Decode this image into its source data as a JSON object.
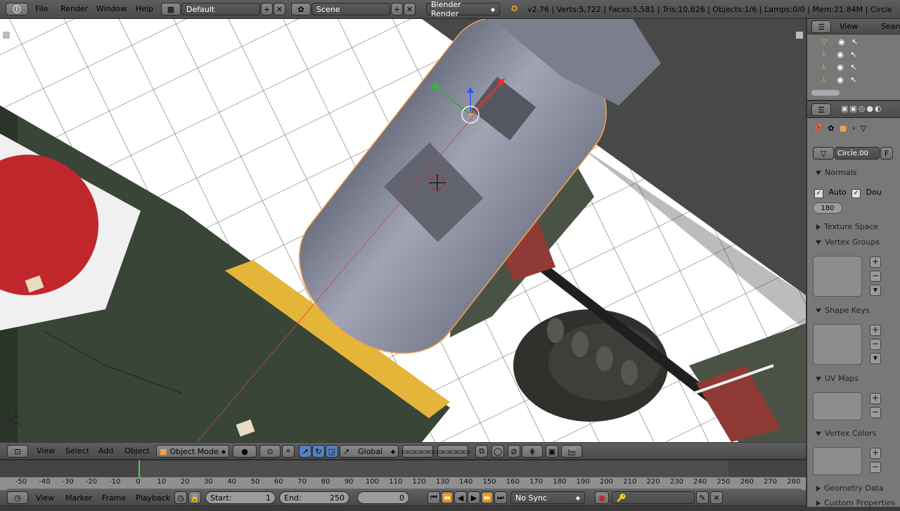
{
  "top": {
    "menus": [
      "File",
      "Render",
      "Window",
      "Help"
    ],
    "layout": "Default",
    "scene": "Scene",
    "engine": "Blender Render",
    "stats": "v2.76 | Verts:5,722 | Faces:5,581 | Tris:10,626 | Objects:1/6 | Lamps:0/0 | Mem:21.84M | Circle"
  },
  "outliner": {
    "view": "View",
    "search": "Search"
  },
  "properties": {
    "mesh_name": "Circle.00",
    "fake_user": "F",
    "normals": "Normals",
    "auto_smooth": "Auto",
    "double_sided": "Dou",
    "angle": "180",
    "panels": [
      "Texture Space",
      "Vertex Groups",
      "Shape Keys",
      "UV Maps",
      "Vertex Colors",
      "Geometry Data",
      "Custom Properties"
    ]
  },
  "view3d_header": {
    "menus": [
      "View",
      "Select",
      "Add",
      "Object"
    ],
    "mode": "Object Mode",
    "orientation": "Global"
  },
  "timeline": {
    "ticks": [
      "-50",
      "-40",
      "-30",
      "-20",
      "-10",
      "0",
      "10",
      "20",
      "30",
      "40",
      "50",
      "60",
      "70",
      "80",
      "90",
      "100",
      "110",
      "120",
      "130",
      "140",
      "150",
      "160",
      "170",
      "180",
      "190",
      "200",
      "210",
      "220",
      "230",
      "240",
      "250",
      "260",
      "270",
      "280"
    ],
    "menus": [
      "View",
      "Marker",
      "Frame",
      "Playback"
    ],
    "start_label": "Start:",
    "start": "1",
    "end_label": "End:",
    "end": "250",
    "current": "0",
    "sync": "No Sync"
  },
  "colors": {
    "accent": "#5680c2",
    "roundel": "#c0272d",
    "hull": "#3b4a36",
    "yellow": "#e5b53a",
    "nacelle": "#8f92a4"
  }
}
